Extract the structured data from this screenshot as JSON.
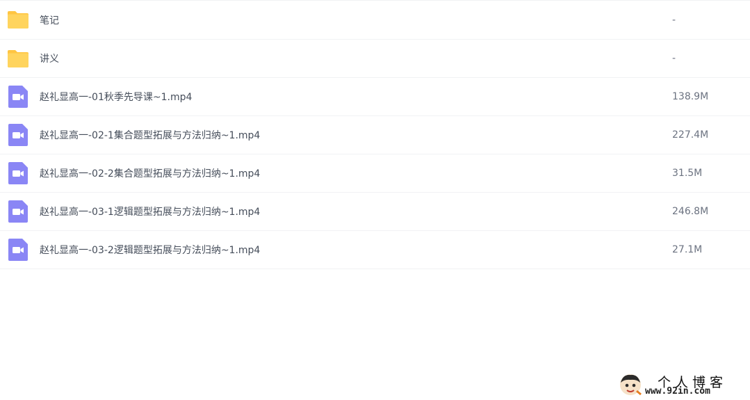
{
  "files": [
    {
      "name": "笔记",
      "size": "-",
      "type": "folder",
      "icon": "folder-icon"
    },
    {
      "name": "讲义",
      "size": "-",
      "type": "folder",
      "icon": "folder-icon"
    },
    {
      "name": "赵礼显高一-01秋季先导课~1.mp4",
      "size": "138.9M",
      "type": "video",
      "icon": "video-file-icon"
    },
    {
      "name": "赵礼显高一-02-1集合题型拓展与方法归纳~1.mp4",
      "size": "227.4M",
      "type": "video",
      "icon": "video-file-icon"
    },
    {
      "name": "赵礼显高一-02-2集合题型拓展与方法归纳~1.mp4",
      "size": "31.5M",
      "type": "video",
      "icon": "video-file-icon"
    },
    {
      "name": "赵礼显高一-03-1逻辑题型拓展与方法归纳~1.mp4",
      "size": "246.8M",
      "type": "video",
      "icon": "video-file-icon"
    },
    {
      "name": "赵礼显高一-03-2逻辑题型拓展与方法归纳~1.mp4",
      "size": "27.1M",
      "type": "video",
      "icon": "video-file-icon"
    }
  ],
  "watermark": {
    "title": "个人博客",
    "url": "www.92in.com"
  },
  "colors": {
    "folder": "#ffd45e",
    "video": "#8a86f5",
    "text": "#454d5a",
    "size_text": "#6b7280",
    "divider": "#f1f2f4"
  }
}
